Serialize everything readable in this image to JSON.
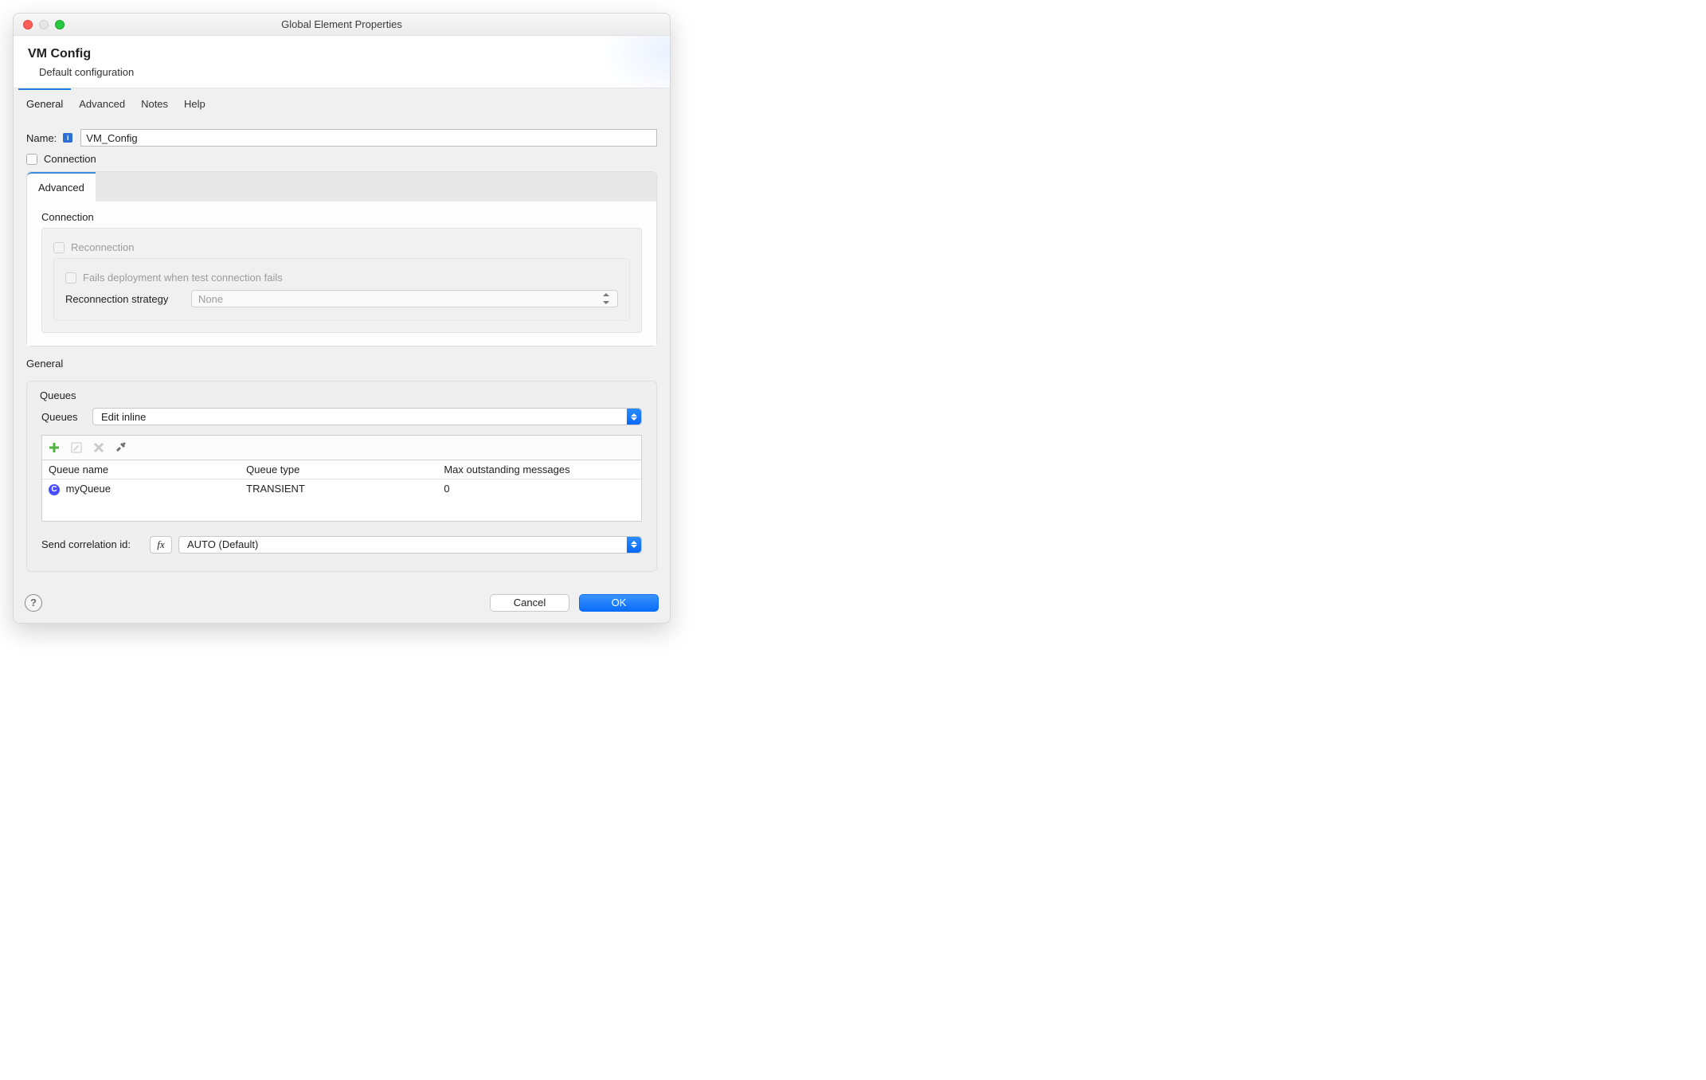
{
  "window": {
    "title": "Global Element Properties"
  },
  "header": {
    "title": "VM Config",
    "subtitle": "Default configuration"
  },
  "tabs": {
    "t0": "General",
    "t1": "Advanced",
    "t2": "Notes",
    "t3": "Help"
  },
  "form": {
    "name_label": "Name:",
    "name_value": "VM_Config",
    "connection_label": "Connection"
  },
  "advanced": {
    "tab": "Advanced",
    "connection_title": "Connection",
    "reconnection_label": "Reconnection",
    "fails_deployment_label": "Fails deployment when test connection fails",
    "reconnection_strategy_label": "Reconnection strategy",
    "reconnection_strategy_value": "None"
  },
  "general": {
    "title": "General",
    "queues_title": "Queues",
    "queues_label": "Queues",
    "queues_mode": "Edit inline",
    "table": {
      "h0": "Queue name",
      "h1": "Queue type",
      "h2": "Max outstanding messages",
      "r0": {
        "name": "myQueue",
        "type": "TRANSIENT",
        "max": "0"
      }
    },
    "correlation_label": "Send correlation id:",
    "correlation_value": "AUTO (Default)",
    "fx": "fx"
  },
  "footer": {
    "help": "?",
    "cancel": "Cancel",
    "ok": "OK"
  }
}
